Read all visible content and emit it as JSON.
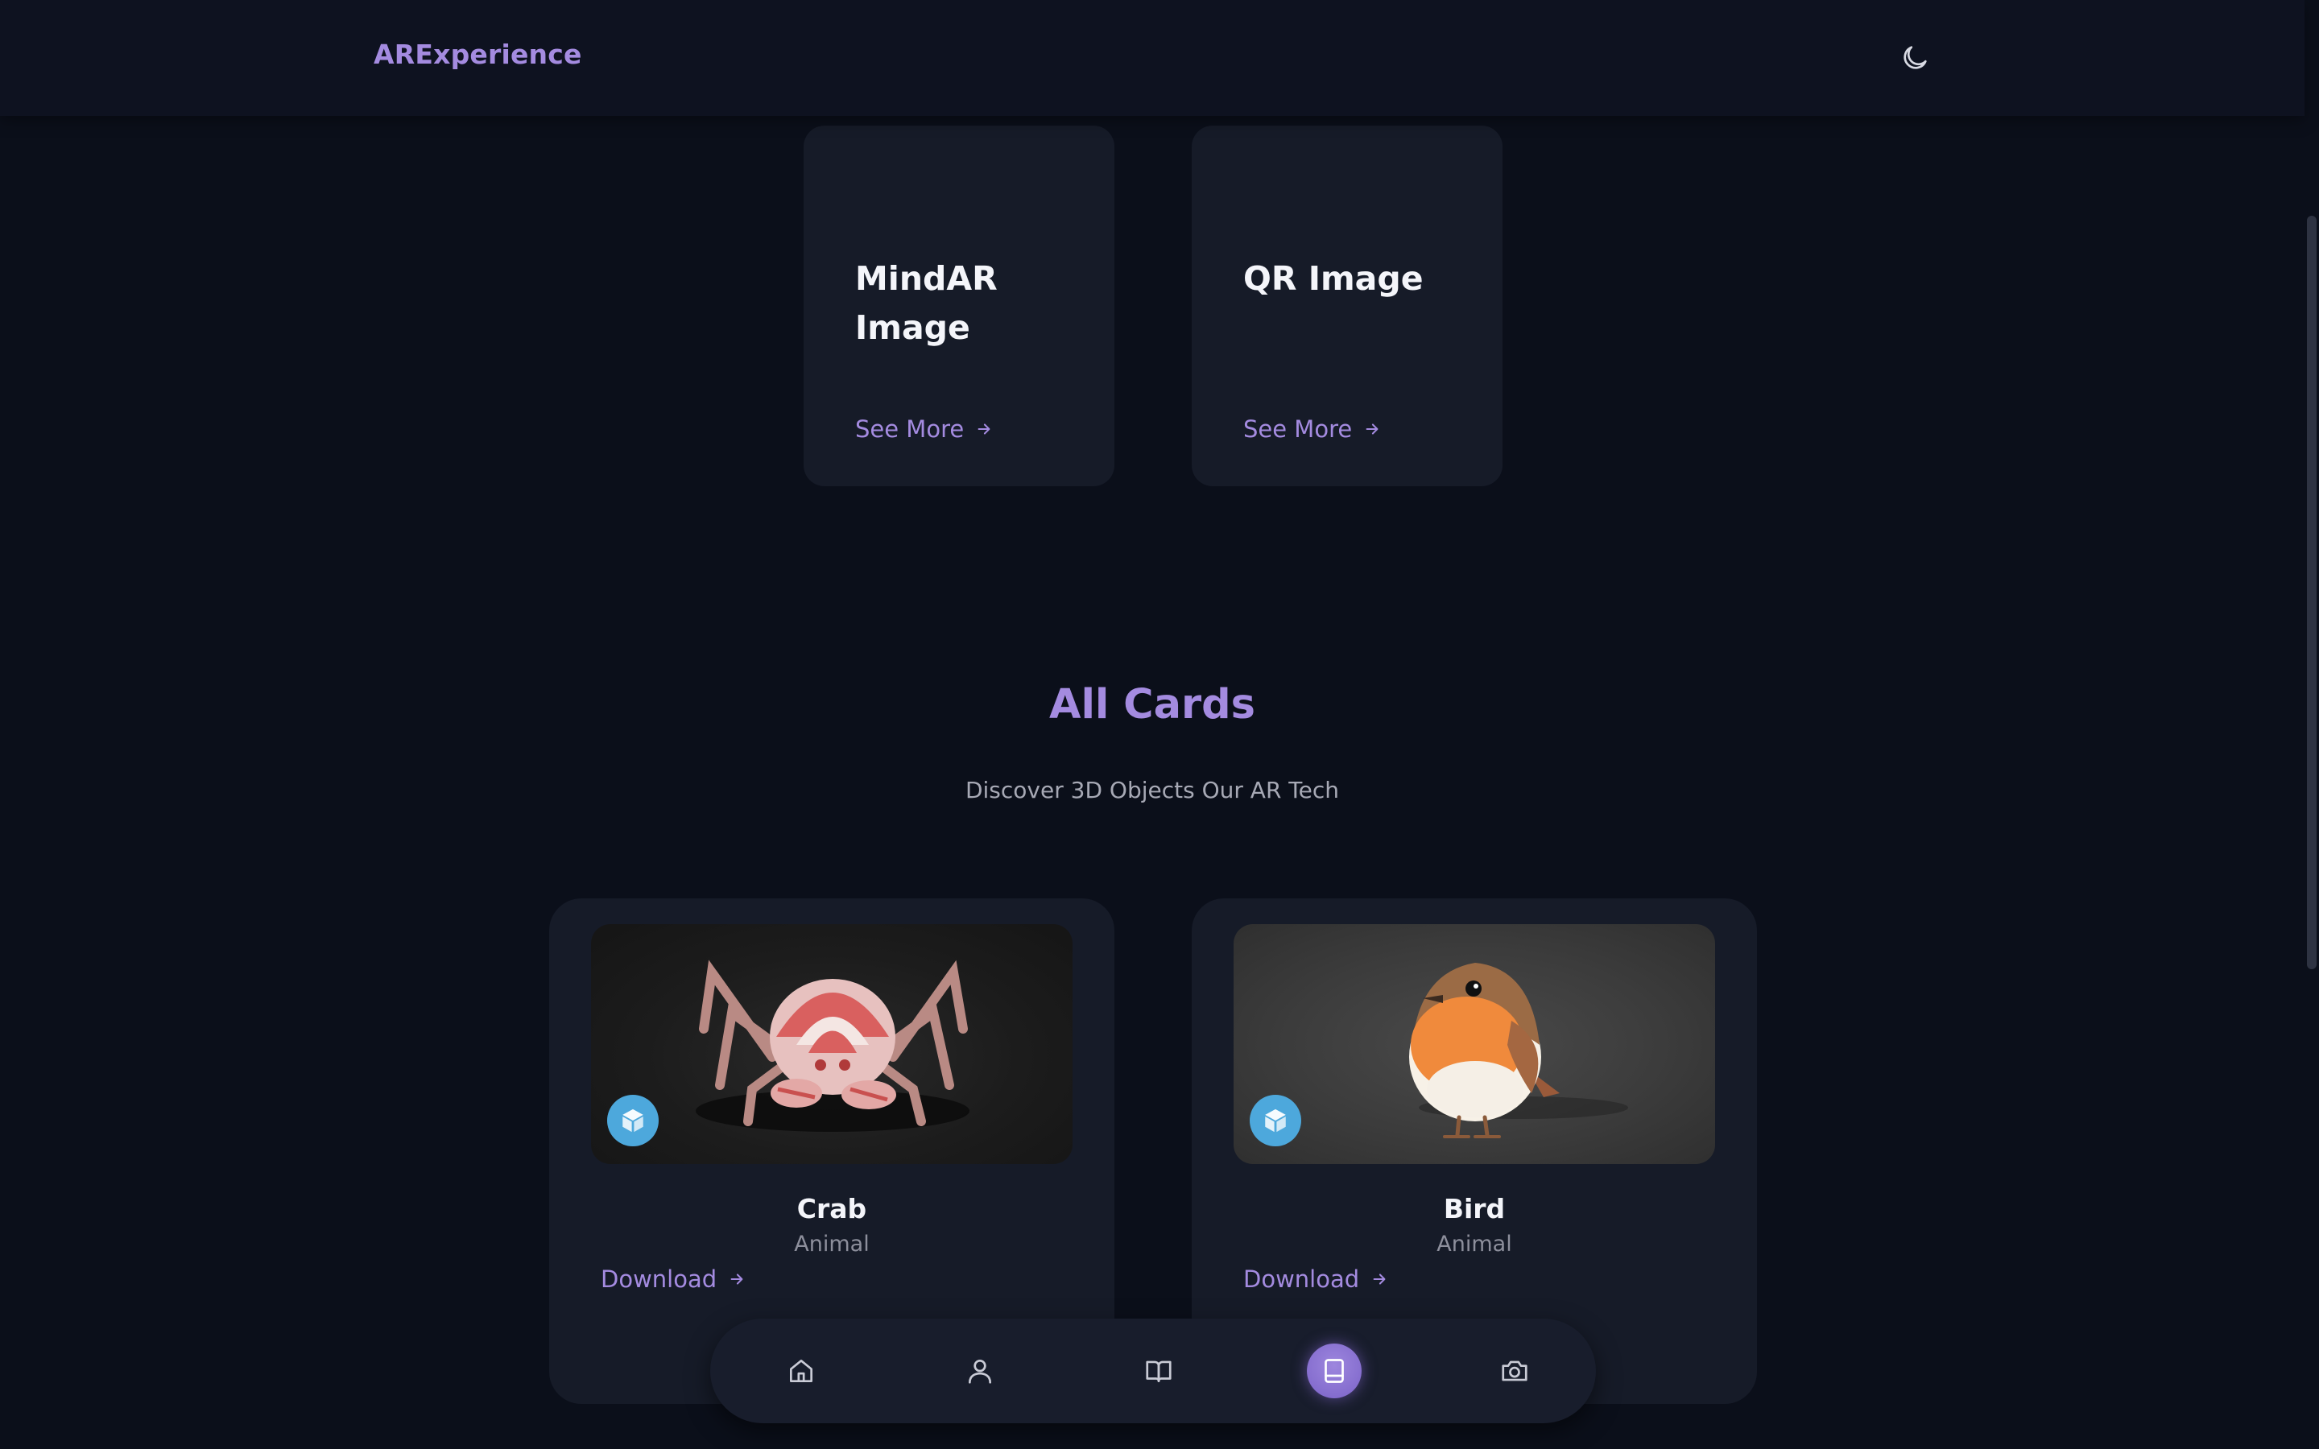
{
  "header": {
    "brand": "ARExperience",
    "theme_icon": "moon-icon"
  },
  "feature_cards": [
    {
      "title": "MindAR Image",
      "link_label": "See More",
      "link_icon": "arrow-right-icon"
    },
    {
      "title": "QR Image",
      "link_label": "See More",
      "link_icon": "arrow-right-icon"
    }
  ],
  "section": {
    "title": "All Cards",
    "subtitle": "Discover 3D Objects Our AR Tech"
  },
  "cards": [
    {
      "name": "Crab",
      "category": "Animal",
      "action_label": "Download",
      "image": "crab-model-image",
      "badge_icon": "cube-icon"
    },
    {
      "name": "Bird",
      "category": "Animal",
      "action_label": "Download",
      "image": "bird-model-image",
      "badge_icon": "cube-icon"
    }
  ],
  "bottom_nav": {
    "items": [
      {
        "icon": "home-icon",
        "active": false
      },
      {
        "icon": "user-icon",
        "active": false
      },
      {
        "icon": "book-open-icon",
        "active": false
      },
      {
        "icon": "cards-icon",
        "active": true
      },
      {
        "icon": "camera-icon",
        "active": false
      }
    ]
  },
  "colors": {
    "background": "#0b0f1a",
    "surface": "#161b28",
    "accent": "#a48be0",
    "badge": "#4da8dc"
  }
}
